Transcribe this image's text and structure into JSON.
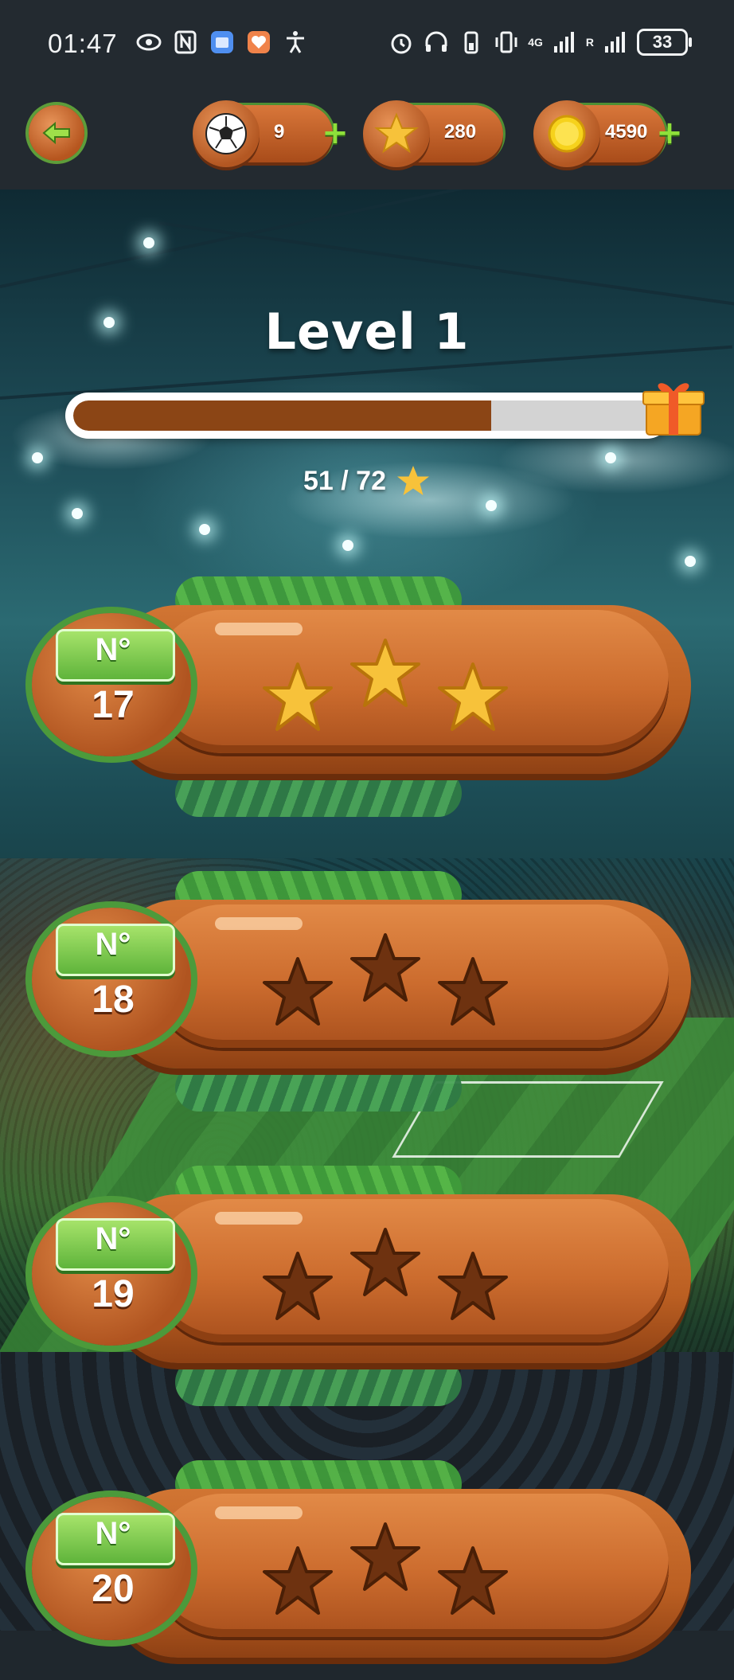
{
  "status_bar": {
    "time": "01:47",
    "network_label": "4G",
    "roaming_label": "R",
    "battery": "33"
  },
  "hud": {
    "balls": {
      "icon": "soccer-ball-icon",
      "value": "9"
    },
    "stars": {
      "icon": "star-icon",
      "value": "280"
    },
    "coins": {
      "icon": "coin-icon",
      "value": "4590"
    }
  },
  "level": {
    "title": "Level 1",
    "progress_text": "51 / 72",
    "progress_fraction": 0.71
  },
  "cards": [
    {
      "label": "N°",
      "number": "17",
      "stars_earned": 3
    },
    {
      "label": "N°",
      "number": "18",
      "stars_earned": 0
    },
    {
      "label": "N°",
      "number": "19",
      "stars_earned": 0
    },
    {
      "label": "N°",
      "number": "20",
      "stars_earned": 0
    }
  ],
  "colors": {
    "wood": "#c96a2b",
    "grass": "#4ea83f",
    "progress_fill": "#8b4515",
    "progress_track": "#d3d3d3",
    "star_gold": "#f7c23a",
    "star_empty": "#6e3210"
  }
}
